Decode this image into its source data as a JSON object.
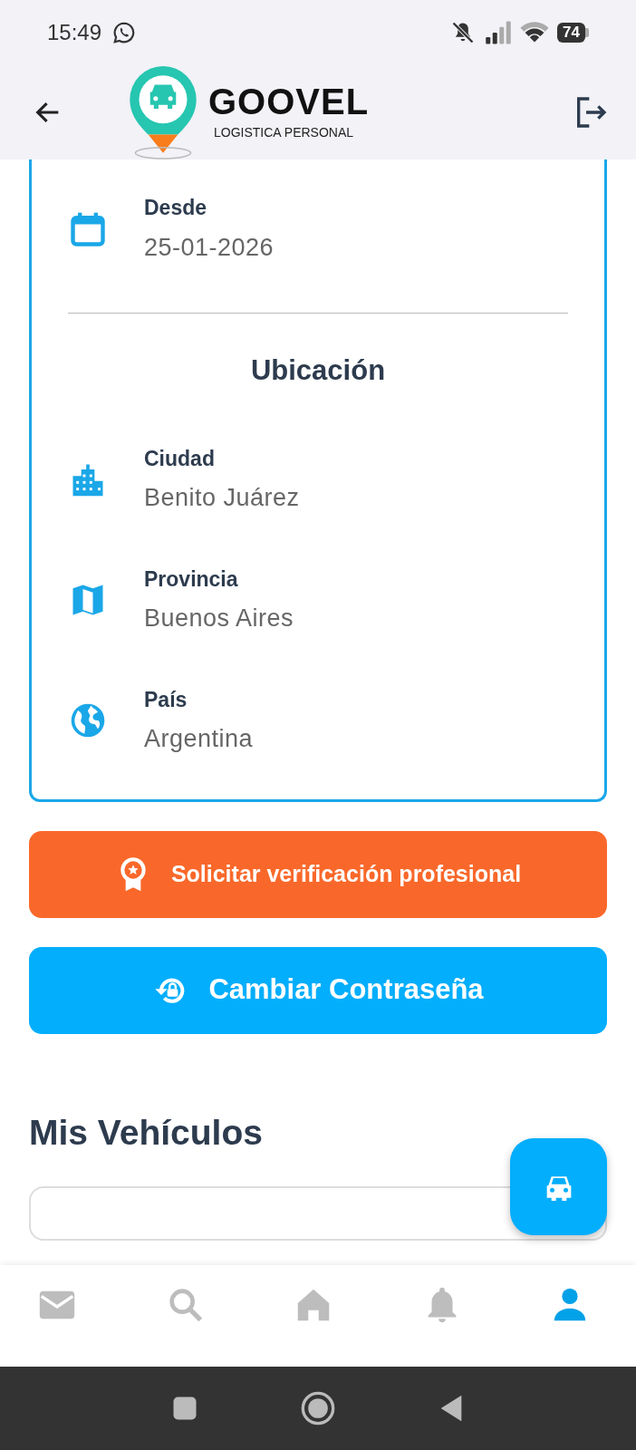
{
  "status_bar": {
    "time": "15:49",
    "battery": "74"
  },
  "header": {
    "brand": "GOOVEL",
    "tagline": "LOGISTICA PERSONAL"
  },
  "profile_card": {
    "fields": [
      {
        "kind": "calendar",
        "label": "Desde",
        "value": "25-01-2026"
      }
    ],
    "section_title": "Ubicación",
    "location_fields": [
      {
        "kind": "city",
        "label": "Ciudad",
        "value": "Benito Juárez"
      },
      {
        "kind": "map",
        "label": "Provincia",
        "value": "Buenos Aires"
      },
      {
        "kind": "globe",
        "label": "País",
        "value": "Argentina"
      }
    ]
  },
  "buttons": [
    {
      "kind": "verify",
      "label": "Solicitar verificación profesional"
    },
    {
      "kind": "password",
      "label": "Cambiar Contraseña"
    }
  ],
  "vehicles_title": "Mis Vehículos",
  "bottom_nav": [
    {
      "kind": "mail",
      "selected": false
    },
    {
      "kind": "search",
      "selected": false
    },
    {
      "kind": "home",
      "selected": false
    },
    {
      "kind": "bell",
      "selected": false
    },
    {
      "kind": "person",
      "selected": true
    }
  ]
}
